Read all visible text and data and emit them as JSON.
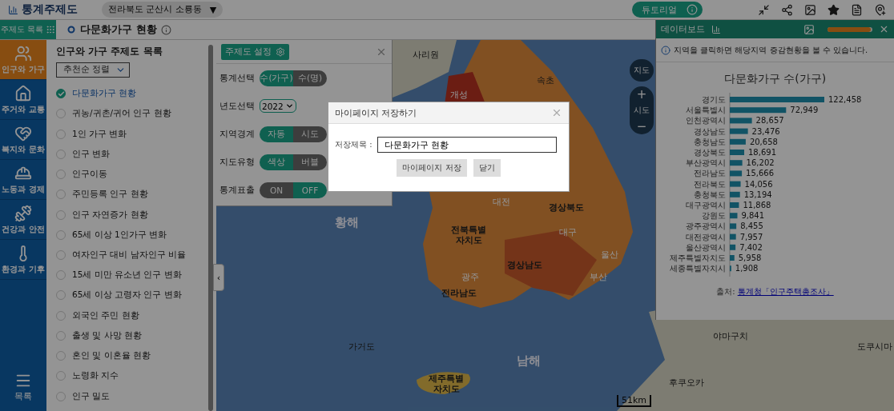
{
  "header": {
    "logo": "통계주제도",
    "region": "전라북도 군산시 소룡동",
    "region_caret": "▼",
    "tutorial": "튜토리얼"
  },
  "subheader": {
    "menu_label": "주제도 목록",
    "map_title": "다문화가구 현황"
  },
  "categories": [
    {
      "label": "인구와 가구",
      "selected": true,
      "kind": "people"
    },
    {
      "label": "주거와 교통",
      "selected": false,
      "kind": "house"
    },
    {
      "label": "복지와 문화",
      "selected": false,
      "kind": "welfare"
    },
    {
      "label": "노동과 경제",
      "selected": false,
      "kind": "labor"
    },
    {
      "label": "건강과 안전",
      "selected": false,
      "kind": "health"
    },
    {
      "label": "환경과 기후",
      "selected": false,
      "kind": "climate"
    }
  ],
  "sidebar_menu": "목록",
  "theme_list": {
    "title": "인구와 가구 주제도 목록",
    "sort": "추천순 정렬",
    "items": [
      {
        "label": "다문화가구 현황",
        "selected": true
      },
      {
        "label": "귀농/귀촌/귀어 인구 현황",
        "selected": false
      },
      {
        "label": "1인 가구 변화",
        "selected": false
      },
      {
        "label": "인구 변화",
        "selected": false
      },
      {
        "label": "인구이동",
        "selected": false
      },
      {
        "label": "주민등록 인구 현황",
        "selected": false
      },
      {
        "label": "인구 자연증가 현황",
        "selected": false
      },
      {
        "label": "65세 이상 1인가구 변화",
        "selected": false
      },
      {
        "label": "여자인구 대비 남자인구 비율",
        "selected": false
      },
      {
        "label": "15세 미만 유소년 인구 변화",
        "selected": false
      },
      {
        "label": "65세 이상 고령자 인구 변화",
        "selected": false
      },
      {
        "label": "외국인 주민 현황",
        "selected": false
      },
      {
        "label": "출생 및 사망 현황",
        "selected": false
      },
      {
        "label": "혼인 및 이혼율 현황",
        "selected": false
      },
      {
        "label": "노령화 지수",
        "selected": false
      },
      {
        "label": "인구 밀도",
        "selected": false
      }
    ]
  },
  "settings": {
    "button": "주제도 설정",
    "rows": [
      {
        "label": "통계선택",
        "kind": "toggle",
        "options": [
          {
            "label": "수(가구)",
            "selected": true
          },
          {
            "label": "수(명)",
            "selected": false
          }
        ]
      },
      {
        "label": "년도선택",
        "kind": "select",
        "value": "2022"
      },
      {
        "label": "지역경계",
        "kind": "toggle",
        "options": [
          {
            "label": "자동",
            "selected": true
          },
          {
            "label": "시도",
            "selected": false
          }
        ]
      },
      {
        "label": "지도유형",
        "kind": "toggle",
        "options": [
          {
            "label": "색상",
            "selected": true
          },
          {
            "label": "버블",
            "selected": false
          }
        ]
      },
      {
        "label": "통계표출",
        "kind": "toggle",
        "options": [
          {
            "label": "ON",
            "selected": false
          },
          {
            "label": "OFF",
            "selected": true
          }
        ]
      }
    ]
  },
  "map_controls": {
    "map_button": "지도",
    "zoom_in": "+",
    "level": "시도",
    "zoom_out": "−",
    "collapse": "‹",
    "scale": "51km"
  },
  "map_labels": [
    {
      "text": "사리원",
      "kind": "place"
    },
    {
      "text": "속초",
      "kind": "place"
    },
    {
      "text": "개성",
      "kind": "city"
    },
    {
      "text": "대전",
      "kind": "city"
    },
    {
      "text": "경상북도",
      "kind": "region"
    },
    {
      "text": "황해",
      "kind": "sea"
    },
    {
      "text": "전북특별자치도",
      "kind": "region"
    },
    {
      "text": "대구",
      "kind": "city"
    },
    {
      "text": "울산",
      "kind": "city"
    },
    {
      "text": "경상남도",
      "kind": "region"
    },
    {
      "text": "광주",
      "kind": "city"
    },
    {
      "text": "부산",
      "kind": "city"
    },
    {
      "text": "전라남도",
      "kind": "region"
    },
    {
      "text": "야마구치",
      "kind": "place"
    },
    {
      "text": "가거도",
      "kind": "place"
    },
    {
      "text": "도쿠시마",
      "kind": "place"
    },
    {
      "text": "남해",
      "kind": "sea"
    },
    {
      "text": "제주특별자치도",
      "kind": "region"
    },
    {
      "text": "후쿠오카",
      "kind": "place"
    }
  ],
  "dashboard": {
    "title": "데이터보드",
    "slider": {
      "level": 0.97
    },
    "notice": "지역을 클릭하면 해당지역 증감현황을 볼 수 있습니다.",
    "source_label": "출처:",
    "source_link": "통계청「인구주택총조사」",
    "chart_data": {
      "type": "bar",
      "orientation": "horizontal",
      "title": "다문화가구 수(가구)",
      "data_labels": true,
      "categories": [
        "경기도",
        "서울특별시",
        "인천광역시",
        "경상남도",
        "충청남도",
        "경상북도",
        "부산광역시",
        "전라남도",
        "전라북도",
        "충청북도",
        "대구광역시",
        "강원도",
        "광주광역시",
        "대전광역시",
        "울산광역시",
        "제주특별자치도",
        "세종특별자치시"
      ],
      "series": [
        {
          "color": "#1e8fae",
          "values": [
            122458,
            72949,
            28657,
            23476,
            20658,
            18691,
            16202,
            15666,
            14056,
            13194,
            11868,
            9841,
            8455,
            7957,
            7402,
            5958,
            1908
          ],
          "value_labels": [
            "122,458",
            "72,949",
            "28,657",
            "23,476",
            "20,658",
            "18,691",
            "16,202",
            "15,666",
            "14,056",
            "13,194",
            "11,868",
            "9,841",
            "8,455",
            "7,957",
            "7,402",
            "5,958",
            "1,908"
          ]
        }
      ]
    }
  },
  "dialog": {
    "title": "마이페이지 저장하기",
    "field_label": "저장제목 :",
    "value": "다문화가구 현황",
    "buttons": [
      "마이페이지 저장",
      "닫기"
    ]
  }
}
